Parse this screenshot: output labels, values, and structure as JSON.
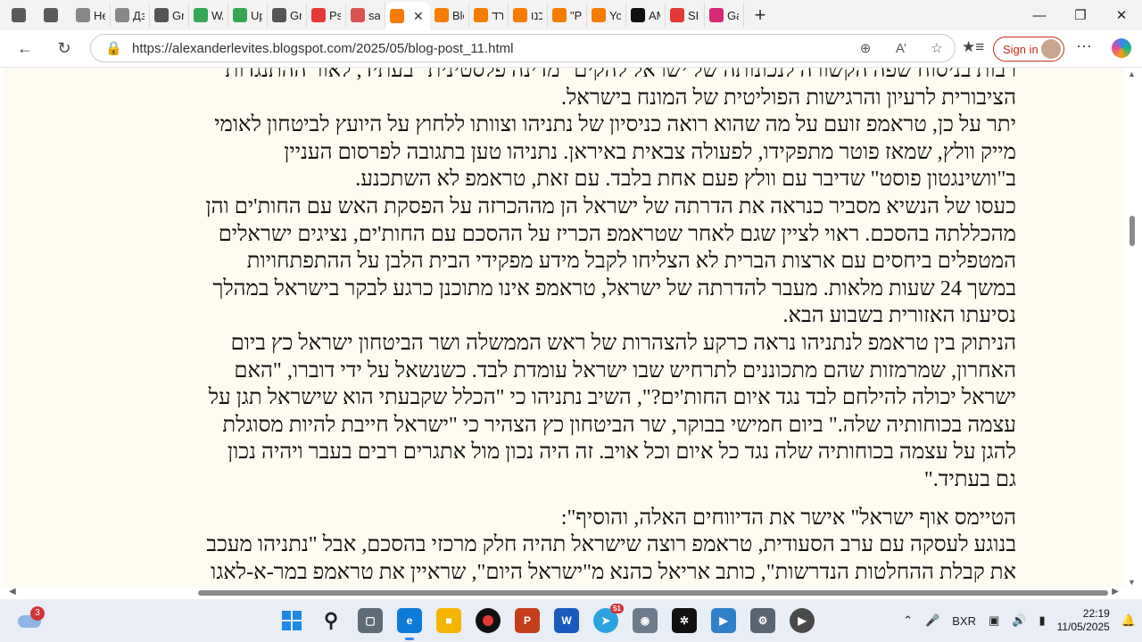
{
  "browser": {
    "tabs": [
      {
        "label": "",
        "icon": "workspaces-icon",
        "color": "#5a5a5a"
      },
      {
        "label": "",
        "icon": "tab-actions-icon",
        "color": "#5a5a5a"
      },
      {
        "label": "Нef",
        "icon": "gray-plus-icon",
        "color": "#888888"
      },
      {
        "label": "Дзе",
        "icon": "gray-plus-icon",
        "color": "#888888"
      },
      {
        "label": "Gro",
        "icon": "x-logo-icon",
        "color": "#555555"
      },
      {
        "label": "WAF",
        "icon": "green-play-icon",
        "color": "#34a853"
      },
      {
        "label": "Uplc",
        "icon": "green-play-icon",
        "color": "#34a853"
      },
      {
        "label": "Gro",
        "icon": "x-logo-icon",
        "color": "#555555"
      },
      {
        "label": "Psin",
        "icon": "pinwheel-icon",
        "color": "#e53935"
      },
      {
        "label": "sas-",
        "icon": "pdf-icon",
        "color": "#d9534f"
      },
      {
        "label": "",
        "icon": "blogger-icon",
        "color": "#f57c00",
        "active": true
      },
      {
        "label": "Blog",
        "icon": "blogger-icon",
        "color": "#f57c00"
      },
      {
        "label": "מרד",
        "icon": "blogger-icon",
        "color": "#f57c00"
      },
      {
        "label": "טכנו",
        "icon": "blogger-icon",
        "color": "#f57c00"
      },
      {
        "label": "\"Par",
        "icon": "blogger-icon",
        "color": "#f57c00"
      },
      {
        "label": "Your",
        "icon": "blogger-icon",
        "color": "#f57c00"
      },
      {
        "label": "AMU",
        "icon": "x-logo-icon",
        "color": "#111111"
      },
      {
        "label": "SINA",
        "icon": "yandex-icon",
        "color": "#e53935"
      },
      {
        "label": "Gal",
        "icon": "instagram-icon",
        "color": "#d62976"
      }
    ],
    "url": "https://alexanderlevites.blogspot.com/2025/05/blog-post_11.html",
    "signin_label": "Sign in"
  },
  "article": {
    "paragraphs": [
      "רבות בניסוח שפה הקשורה לנכונותה של ישראל להקים \"מדינה פלסטינית\" בעתיד, לאור ההתנגדות",
      "הציבורית לרעיון והרגישות הפוליטית של המונח בישראל.",
      "יתר על כן, טראמפ זועם על מה שהוא רואה כניסיון של נתניהו וצוותו ללחוץ על היועץ לביטחון לאומי",
      "מייק וולץ, שמאז פוטר מתפקידו, לפעולה צבאית באיראן. נתניהו טען בתגובה לפרסום העניין",
      "ב\"וושינגטון פוסט\" שדיבר עם וולץ פעם אחת בלבד. עם זאת, טראמפ לא השתכנע.",
      "כעסו של הנשיא מסביר כנראה את הדרתה של ישראל הן מההכרזה על הפסקת האש עם החות'ים והן",
      "מהכללתה בהסכם. ראוי לציין שגם לאחר שטראמפ הכריז על ההסכם עם החות'ים, נציגים ישראלים",
      "המטפלים ביחסים עם ארצות הברית לא הצליחו לקבל מידע מפקידי הבית הלבן על ההתפתחויות",
      "במשך 24 שעות מלאות. מעבר להדרתה של ישראל, טראמפ אינו מתוכנן כרגע לבקר בישראל במהלך",
      "נסיעתו האזורית בשבוע הבא.",
      "הניתוק בין טראמפ לנתניהו נראה כרקע להצהרות של ראש הממשלה ושר הביטחון ישראל כץ ביום",
      "האחרון, שמרמזות שהם מתכוננים לתרחיש שבו ישראל עומדת לבד. כשנשאל על ידי דוברו, \"האם",
      "ישראל יכולה להילחם לבד נגד איום החות'ים?\", השיב נתניהו כי \"הכלל שקבעתי הוא שישראל תגן על",
      "עצמה בכוחותיה שלה.\" ביום חמישי בבוקר, שר הביטחון כץ הצהיר כי \"ישראל חייבת להיות מסוגלת",
      "להגן על עצמה בכוחותיה שלה נגד כל איום וכל אויב. זה היה נכון מול אתגרים רבים בעבר ויהיה נכון",
      "גם בעתיד.\"",
      "הטיימס אוף ישראל\" אישר את הדיווחים האלה, והוסיף\":",
      "בנוגע לעסקה עם ערב הסעודית, טראמפ רוצה שישראל תהיה חלק מרכזי בהסכם, אבל \"נתניהו מעכב",
      "את קבלת ההחלטות הנדרשות\", כותב אריאל כהנא מ\"ישראל היום\", שראיין את טראמפ במר-א-לאגו"
    ]
  },
  "taskbar": {
    "weather_badge": "3",
    "telegram_badge": "51",
    "language": "BXR",
    "time": "22:19",
    "date": "11/05/2025"
  }
}
